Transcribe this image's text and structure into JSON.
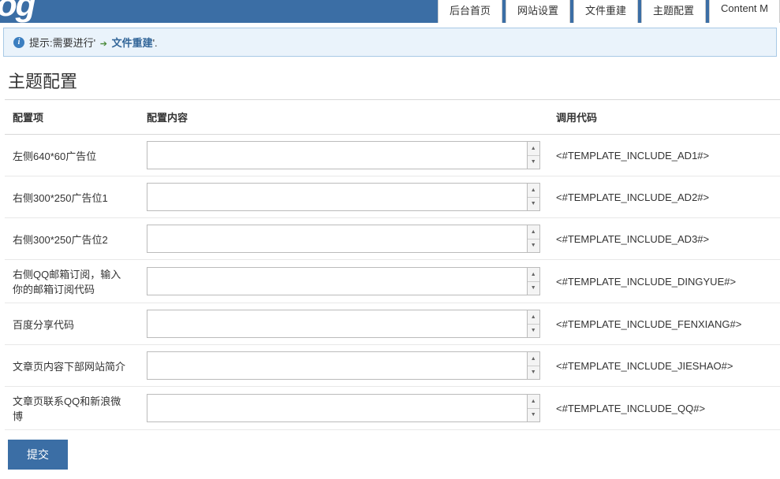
{
  "header": {
    "logo_fragment": "og",
    "tabs": [
      {
        "label": "后台首页"
      },
      {
        "label": "网站设置"
      },
      {
        "label": "文件重建"
      },
      {
        "label": "主题配置"
      },
      {
        "label": "Content M"
      }
    ]
  },
  "alert": {
    "prefix": "提示:需要进行' ",
    "link": "文件重建",
    "suffix": "'."
  },
  "page_title": "主题配置",
  "table": {
    "headers": {
      "item": "配置项",
      "content": "配置内容",
      "code": "调用代码"
    },
    "rows": [
      {
        "item": "左侧640*60广告位",
        "value": "",
        "code": "<#TEMPLATE_INCLUDE_AD1#>"
      },
      {
        "item": "右侧300*250广告位1",
        "value": "",
        "code": "<#TEMPLATE_INCLUDE_AD2#>"
      },
      {
        "item": "右侧300*250广告位2",
        "value": "",
        "code": "<#TEMPLATE_INCLUDE_AD3#>"
      },
      {
        "item": "右侧QQ邮箱订阅，输入你的邮箱订阅代码",
        "value": "",
        "code": "<#TEMPLATE_INCLUDE_DINGYUE#>"
      },
      {
        "item": "百度分享代码",
        "value": "",
        "code": "<#TEMPLATE_INCLUDE_FENXIANG#>"
      },
      {
        "item": "文章页内容下部网站简介",
        "value": "",
        "code": "<#TEMPLATE_INCLUDE_JIESHAO#>"
      },
      {
        "item": "文章页联系QQ和新浪微博",
        "value": "",
        "code": "<#TEMPLATE_INCLUDE_QQ#>"
      }
    ]
  },
  "submit_label": "提交"
}
